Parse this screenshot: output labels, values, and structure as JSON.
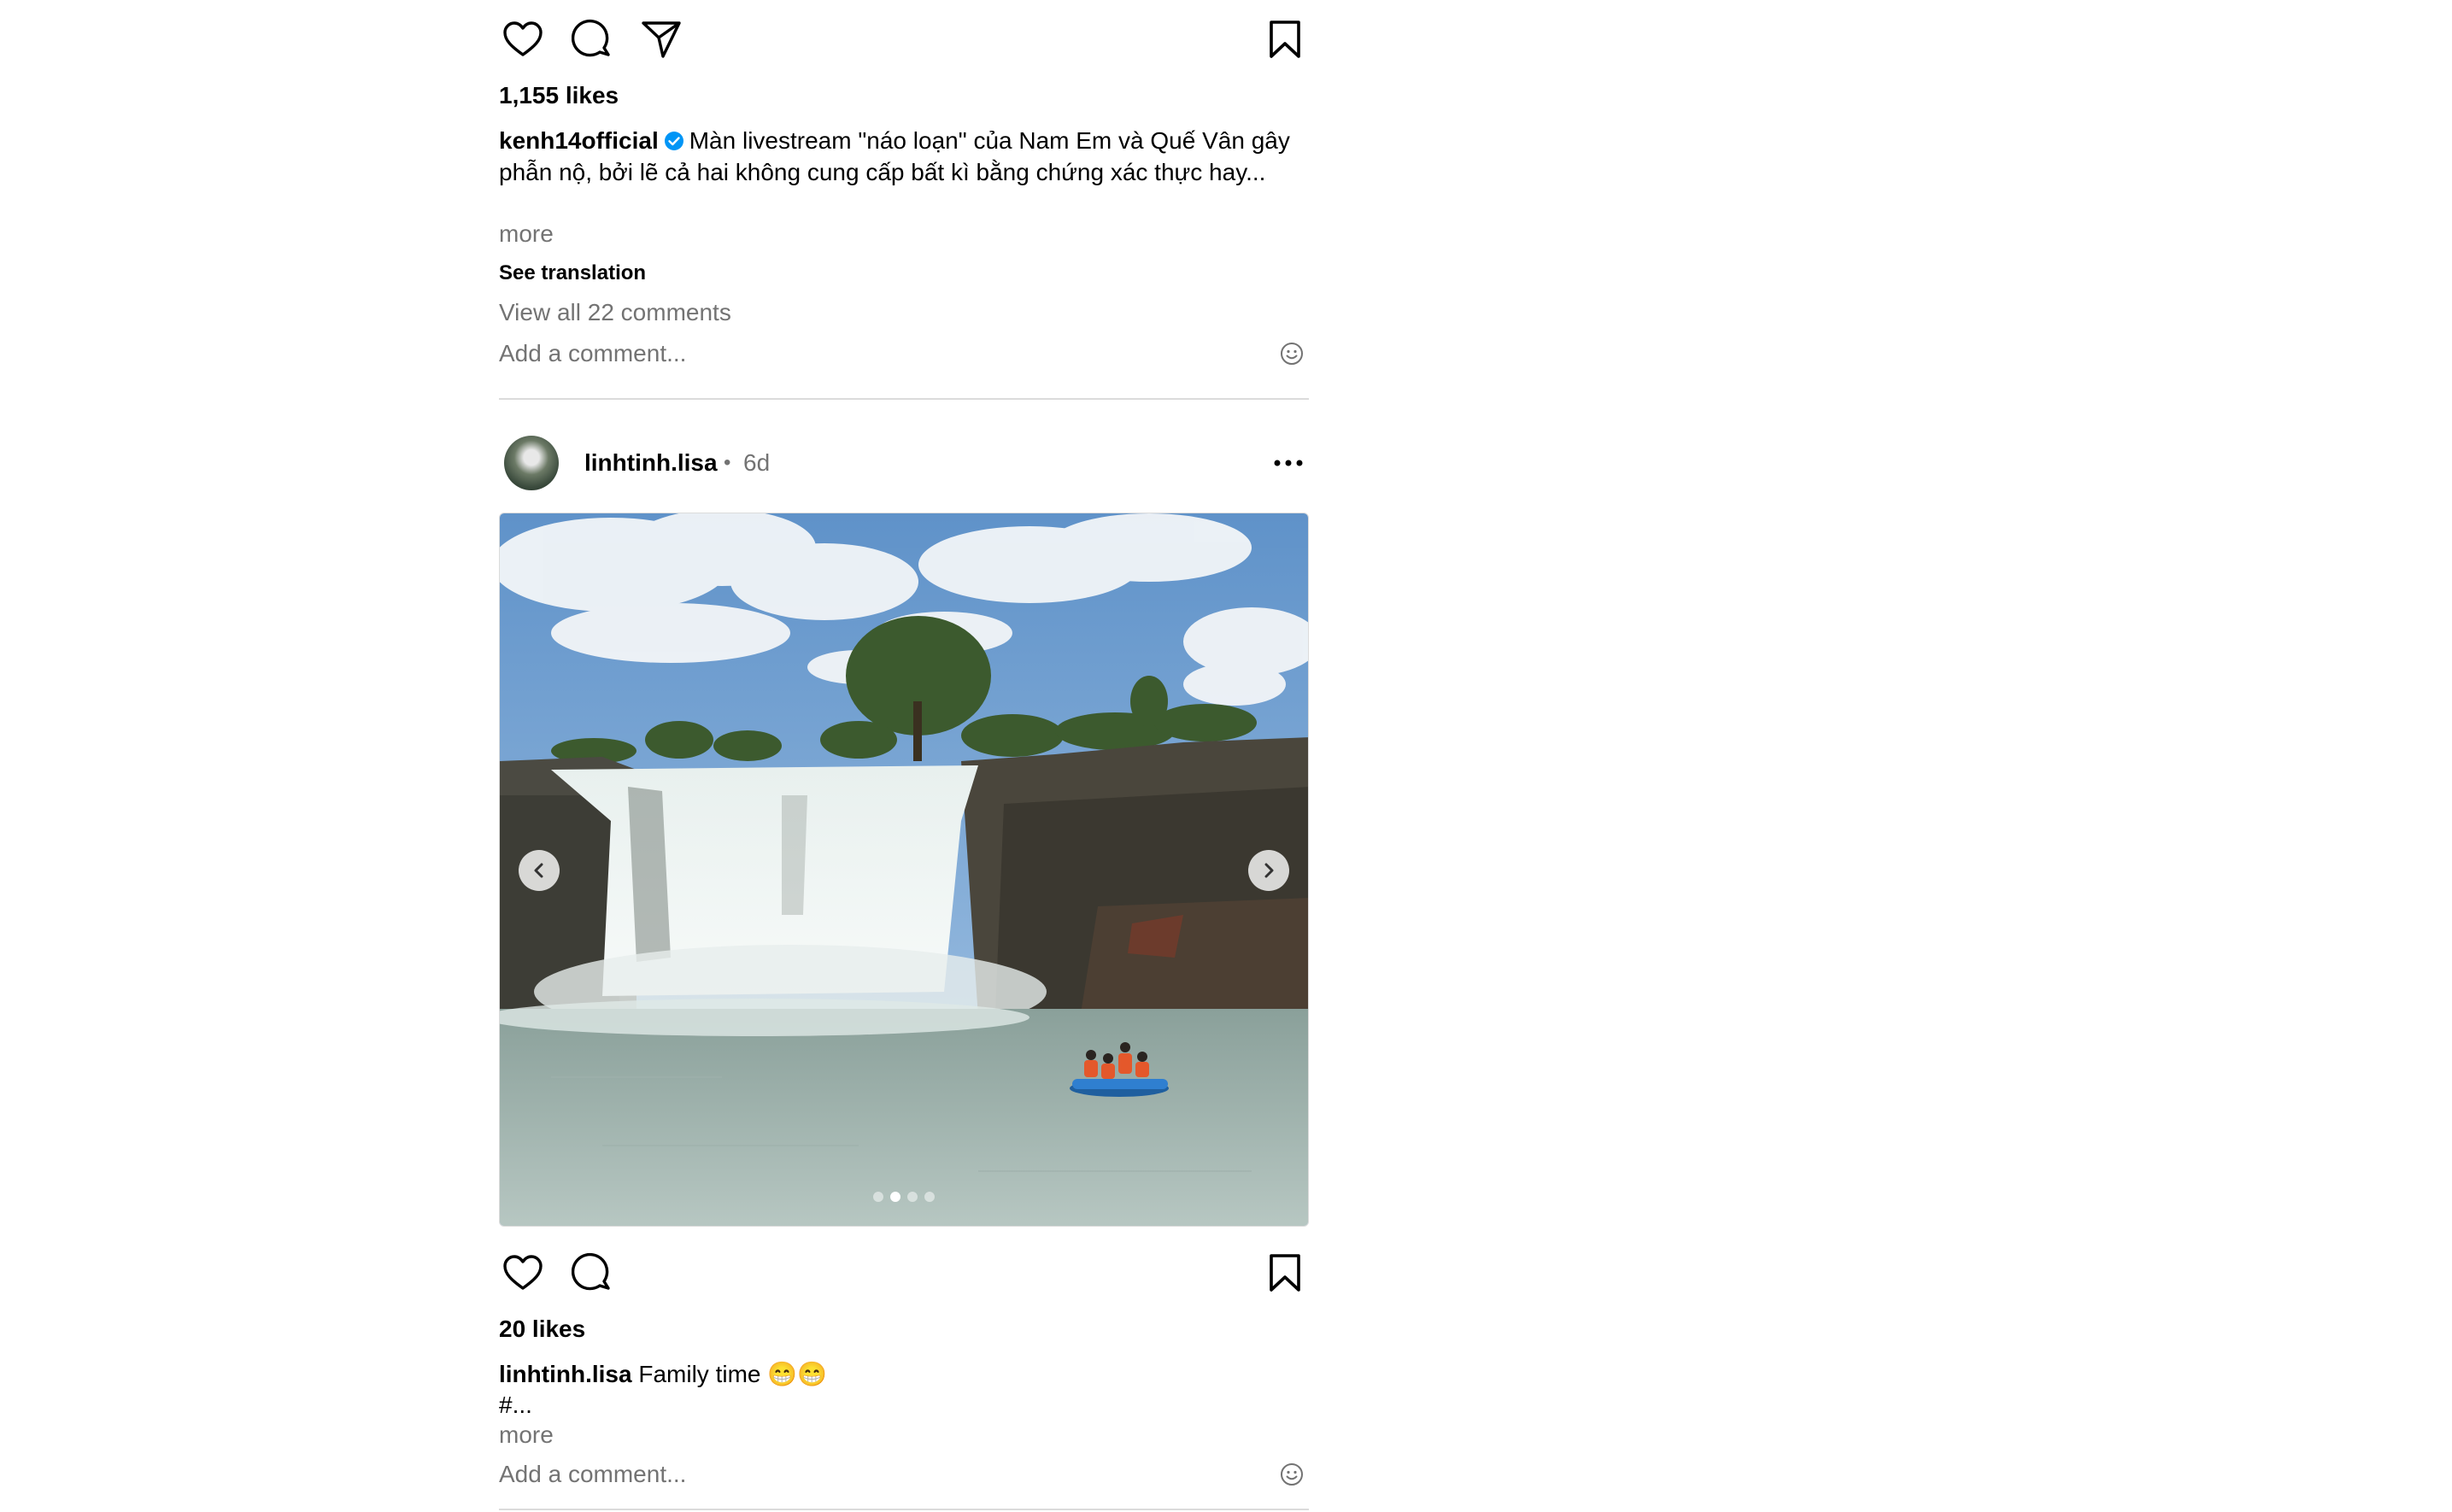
{
  "colors": {
    "secondary_text": "#737373",
    "divider": "#dbdbdb",
    "verified_blue": "#0095f6"
  },
  "post1": {
    "likes": "1,155 likes",
    "username": "kenh14official",
    "verified": true,
    "caption_text": "Màn livestream \"náo loạn\" của Nam Em và Quế Vân gây phẫn nộ, bởi lẽ cả hai không cung cấp bất kì bằng chứng xác thực hay...",
    "more_label": "more",
    "see_translation": "See translation",
    "view_comments": "View all 22 comments",
    "comment_placeholder": "Add a comment...",
    "icons": [
      "heart-icon",
      "comment-icon",
      "share-icon",
      "bookmark-icon",
      "emoji-icon"
    ]
  },
  "post2": {
    "username": "linhtinh.lisa",
    "dot": "•",
    "time": "6d",
    "carousel_total": 4,
    "carousel_active_index": 1,
    "likes": "20 likes",
    "caption_username": "linhtinh.lisa",
    "caption_text": "Family time 😁😁",
    "caption_line2": "#...",
    "more_label": "more",
    "comment_placeholder": "Add a comment...",
    "icons": [
      "heart-icon",
      "comment-icon",
      "bookmark-icon",
      "more-options-icon",
      "chevron-left-icon",
      "chevron-right-icon",
      "emoji-icon"
    ]
  }
}
